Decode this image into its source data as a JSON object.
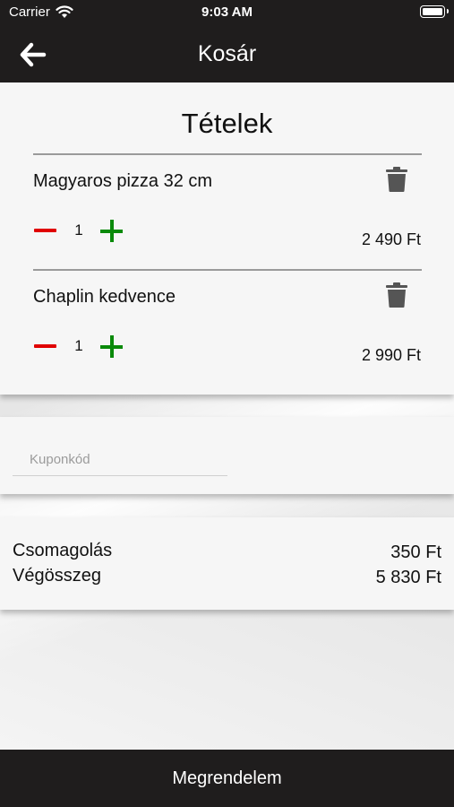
{
  "status_bar": {
    "carrier": "Carrier",
    "time": "9:03 AM"
  },
  "header": {
    "title": "Kosár",
    "back_icon": "arrow-left-icon"
  },
  "items_section": {
    "title": "Tételek",
    "items": [
      {
        "name": "Magyaros pizza 32 cm",
        "quantity": "1",
        "price": "2 490 Ft"
      },
      {
        "name": "Chaplin kedvence",
        "quantity": "1",
        "price": "2 990 Ft"
      }
    ]
  },
  "coupon": {
    "placeholder": "Kuponkód",
    "value": ""
  },
  "totals": {
    "packaging_label": "Csomagolás",
    "packaging_value": "350 Ft",
    "total_label": "Végösszeg",
    "total_value": "5 830 Ft"
  },
  "order_button": {
    "label": "Megrendelem"
  },
  "colors": {
    "header_bg": "#1f1d1d",
    "minus": "#e00000",
    "plus": "#0a8a0a",
    "trash": "#555555"
  }
}
